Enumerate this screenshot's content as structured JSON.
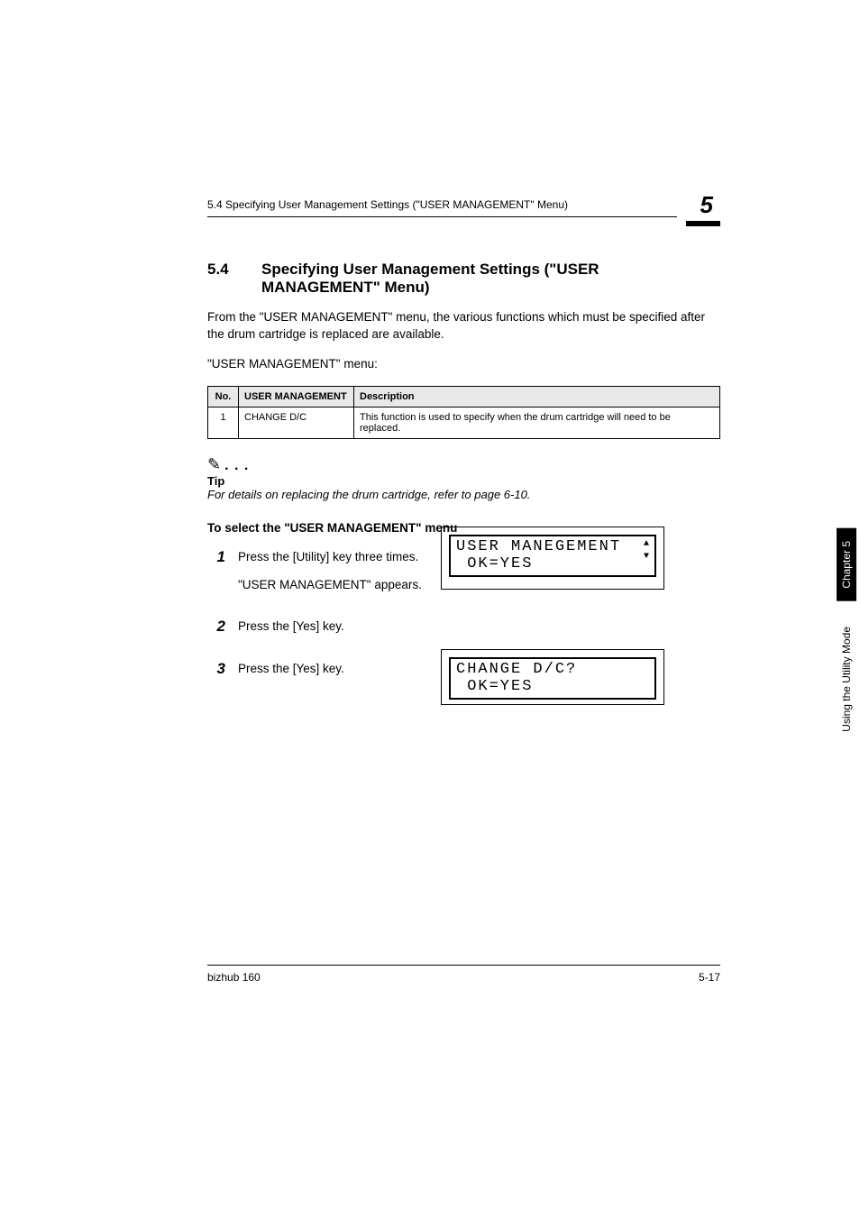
{
  "header": {
    "running_title": "5.4 Specifying User Management Settings (\"USER MANAGEMENT\" Menu)",
    "chapter_num": "5"
  },
  "section": {
    "number": "5.4",
    "title": "Specifying User Management Settings (\"USER MANAGEMENT\" Menu)"
  },
  "paragraphs": {
    "intro": "From the \"USER MANAGEMENT\" menu, the various functions which must be specified after the drum cartridge is replaced are available.",
    "menu_label": "\"USER MANAGEMENT\" menu:"
  },
  "table": {
    "headers": {
      "no": "No.",
      "um": "USER MANAGEMENT",
      "desc": "Description"
    },
    "rows": [
      {
        "no": "1",
        "um": "CHANGE D/C",
        "desc": "This function is used to specify when the drum cartridge will need to be replaced."
      }
    ]
  },
  "tip": {
    "label": "Tip",
    "text": "For details on replacing the drum cartridge, refer to page 6-10."
  },
  "subheading": "To select the \"USER MANAGEMENT\" menu",
  "steps": [
    {
      "num": "1",
      "lines": [
        "Press the [Utility] key three times.",
        "\"USER MANAGEMENT\" appears."
      ]
    },
    {
      "num": "2",
      "lines": [
        "Press the [Yes] key."
      ]
    },
    {
      "num": "3",
      "lines": [
        "Press the [Yes] key."
      ]
    }
  ],
  "lcd": {
    "screen1": {
      "line1": "USER MANEGEMENT",
      "line2": " OK=YES"
    },
    "screen2": {
      "line1": "CHANGE D/C?",
      "line2": " OK=YES"
    }
  },
  "tabs": {
    "chapter": "Chapter 5",
    "mode": "Using the Utility Mode"
  },
  "footer": {
    "product": "bizhub 160",
    "page": "5-17"
  }
}
